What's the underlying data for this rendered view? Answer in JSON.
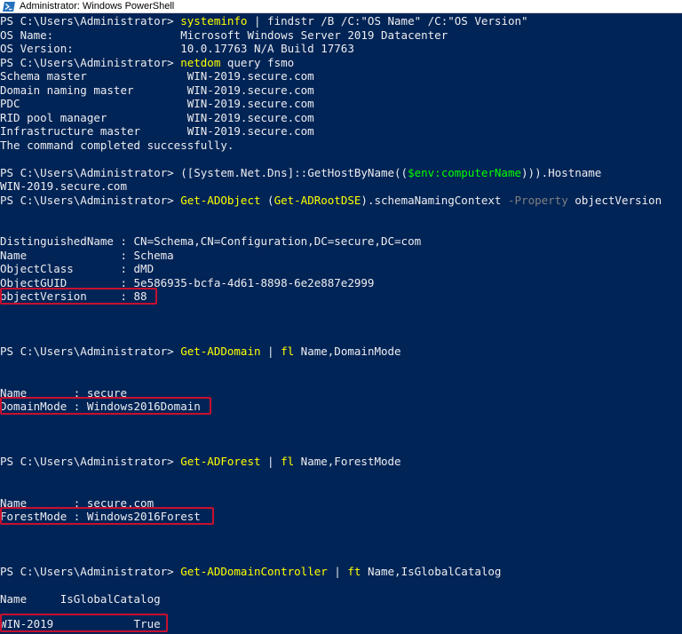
{
  "window": {
    "title": "Administrator: Windows PowerShell",
    "icon": "powershell-icon"
  },
  "colors": {
    "console_bg": "#012456",
    "text": "#eeedf0",
    "command": "#ffff00",
    "parameter": "#808080",
    "variable": "#00ff00",
    "highlight": "#c8102e"
  },
  "console": {
    "prompt": "PS C:\\Users\\Administrator> ",
    "l1": {
      "cmd": "systeminfo",
      "rest": " | findstr /B /C:\"OS Name\" /C:\"OS Version\""
    },
    "l2": "OS Name:                   Microsoft Windows Server 2019 Datacenter",
    "l3": "OS Version:                10.0.17763 N/A Build 17763",
    "l4": {
      "cmd": "netdom",
      "rest": " query fsmo"
    },
    "l5": "Schema master               WIN-2019.secure.com",
    "l6": "Domain naming master        WIN-2019.secure.com",
    "l7": "PDC                         WIN-2019.secure.com",
    "l8": "RID pool manager            WIN-2019.secure.com",
    "l9": "Infrastructure master       WIN-2019.secure.com",
    "l10": "The command completed successfully.",
    "l12": {
      "pre": "([System.Net.Dns]::GetHostByName((",
      "var": "$env:computerName",
      "post": "))).Hostname"
    },
    "l13": "WIN-2019.secure.com",
    "l14": {
      "cmd1": "Get-ADObject",
      "mid1": " (",
      "cmd2": "Get-ADRootDSE",
      "mid2": ").schemaNamingContext ",
      "param": "-Property",
      "post": " objectVersion"
    },
    "l17": "DistinguishedName : CN=Schema,CN=Configuration,DC=secure,DC=com",
    "l18": "Name              : Schema",
    "l19": "ObjectClass       : dMD",
    "l20": "ObjectGUID        : 5e586935-bcfa-4d61-8898-6e2e887e2999",
    "l21": "objectVersion     : 88",
    "l25": {
      "cmd1": "Get-ADDomain",
      "mid": " | ",
      "cmd2": "fl",
      "post": " Name,DomainMode"
    },
    "l28": "Name       : secure",
    "l29": "DomainMode : Windows2016Domain",
    "l33": {
      "cmd1": "Get-ADForest",
      "mid": " | ",
      "cmd2": "fl",
      "post": " Name,ForestMode"
    },
    "l36": "Name       : secure.com",
    "l37": "ForestMode : Windows2016Forest",
    "l41": {
      "cmd1": "Get-ADDomainController",
      "mid": " | ",
      "cmd2": "ft",
      "post": " Name,IsGlobalCatalog"
    },
    "l43": "Name     IsGlobalCatalog",
    "l44": "----     ---------------",
    "l45": "WIN-2019            True"
  }
}
